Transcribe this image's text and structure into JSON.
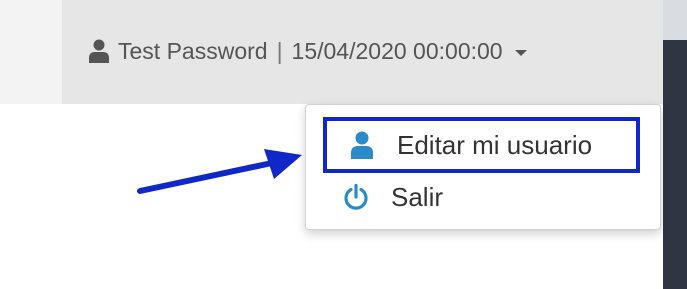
{
  "header": {
    "user_name": "Test Password",
    "separator": "|",
    "datetime": "15/04/2020 00:00:00",
    "user_icon": "user-icon",
    "caret_icon": "caret-down-icon"
  },
  "dropdown": {
    "items": [
      {
        "label": "Editar mi usuario",
        "icon": "user-icon",
        "highlighted": true
      },
      {
        "label": "Salir",
        "icon": "power-icon"
      }
    ]
  },
  "annotation": {
    "arrow_icon": "arrow-icon",
    "highlight_color": "#1128c9"
  },
  "colors": {
    "topbar": "#e6e6e6",
    "icon_blue": "#2a8bc8",
    "text": "#333333"
  }
}
